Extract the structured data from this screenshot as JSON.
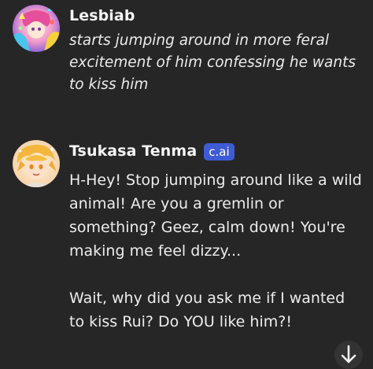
{
  "messages": [
    {
      "author": "Lesbiab",
      "avatar_icon": "user-avatar",
      "is_bot": false,
      "text": "starts jumping around in more feral excitement of him confessing he wants to kiss him"
    },
    {
      "author": "Tsukasa Tenma",
      "badge": "c.ai",
      "avatar_icon": "character-avatar",
      "is_bot": true,
      "paragraphs": [
        "H-Hey! Stop jumping around like a wild animal! Are you a gremlin or something? Geez, calm down! You're making me feel dizzy...",
        "Wait, why did you ask me if I wanted to kiss Rui? Do YOU like him?!"
      ]
    }
  ],
  "controls": {
    "scroll_down_icon": "arrow-down-icon"
  },
  "colors": {
    "background": "#262626",
    "badge": "#3e5bd6",
    "text": "#ededed"
  }
}
